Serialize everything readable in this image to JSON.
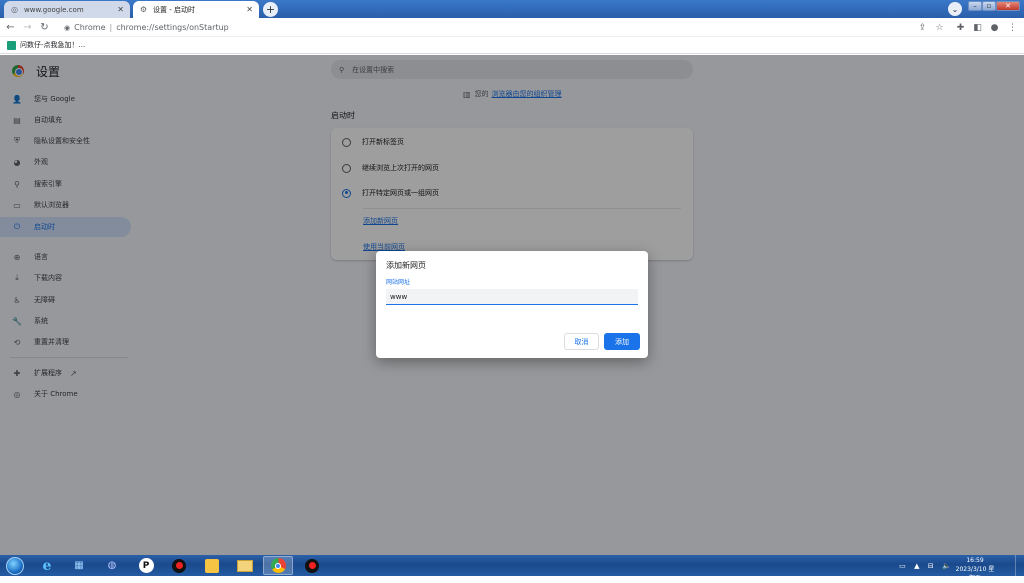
{
  "browser": {
    "tabs": [
      {
        "title": "www.google.com",
        "icon": "globe-icon"
      },
      {
        "title": "设置 - 启动时",
        "icon": "gear-icon"
      }
    ],
    "address": {
      "site_label": "Chrome",
      "url": "chrome://settings/onStartup"
    },
    "bookmarks": [
      {
        "label": "问数仔-点我急加！..."
      }
    ]
  },
  "settings": {
    "title": "设置",
    "search_placeholder": "在设置中搜索",
    "nav": [
      {
        "label": "您与 Google",
        "icon": "person-icon"
      },
      {
        "label": "自动填充",
        "icon": "autofill-icon"
      },
      {
        "label": "隐私设置和安全性",
        "icon": "shield-icon"
      },
      {
        "label": "外观",
        "icon": "palette-icon"
      },
      {
        "label": "搜索引擎",
        "icon": "search-icon"
      },
      {
        "label": "默认浏览器",
        "icon": "browser-icon"
      },
      {
        "label": "启动时",
        "icon": "power-icon",
        "active": true
      },
      {
        "label": "语言",
        "icon": "globe-icon"
      },
      {
        "label": "下载内容",
        "icon": "download-icon"
      },
      {
        "label": "无障碍",
        "icon": "accessibility-icon"
      },
      {
        "label": "系统",
        "icon": "wrench-icon"
      },
      {
        "label": "重置并清理",
        "icon": "reset-icon"
      },
      {
        "label": "扩展程序",
        "icon": "puzzle-icon"
      },
      {
        "label": "关于 Chrome",
        "icon": "chrome-icon"
      }
    ],
    "managed_prefix": "您的",
    "managed_link": "浏览器由您的组织管理",
    "section_title": "启动时",
    "options": [
      {
        "label": "打开新标签页",
        "selected": false
      },
      {
        "label": "继续浏览上次打开的网页",
        "selected": false
      },
      {
        "label": "打开特定网页或一组网页",
        "selected": true
      }
    ],
    "links": {
      "add_page": "添加新网页",
      "use_current": "使用当前网页"
    }
  },
  "dialog": {
    "title": "添加新网页",
    "field_label": "网站网址",
    "field_value": "www",
    "cancel": "取消",
    "add": "添加"
  },
  "taskbar": {
    "apps": [
      "ie-icon",
      "folder-icon",
      "network-icon",
      "p-app-icon",
      "record-icon",
      "sticky-icon",
      "explorer-icon",
      "chrome-icon",
      "record-icon"
    ],
    "time": "16:59",
    "date": "2023/3/10 星期五"
  }
}
